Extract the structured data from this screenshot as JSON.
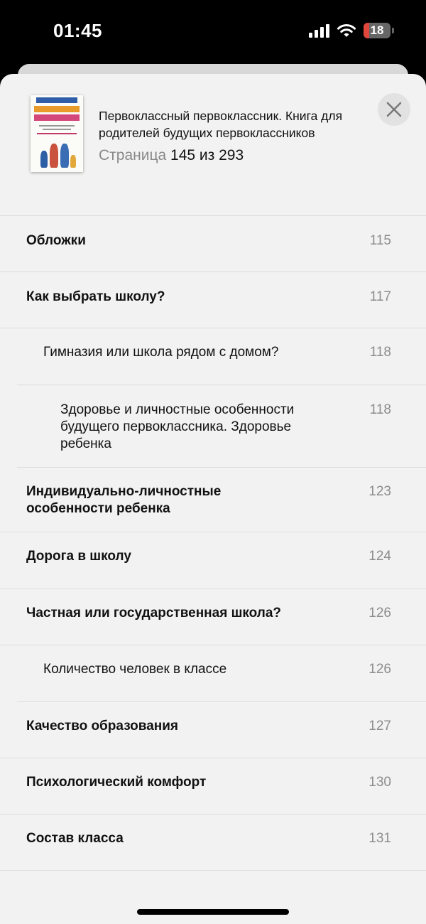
{
  "status_bar": {
    "time": "01:45",
    "battery_level": "18"
  },
  "book": {
    "title": "Первоклассный первоклассник. Книга для родителей будущих первоклассников",
    "page_label": "Страница",
    "page_current": "145",
    "page_of": "из",
    "page_total": "293"
  },
  "toc": [
    {
      "label": "Обложки",
      "page": "115",
      "level": 1
    },
    {
      "label": "Как выбрать школу?",
      "page": "117",
      "level": 1
    },
    {
      "label": "Гимназия или школа рядом с домом?",
      "page": "118",
      "level": 2
    },
    {
      "label": "Здоровье и личностные особенности будущего первоклассника. Здоровье ребенка",
      "page": "118",
      "level": 3
    },
    {
      "label": "Индивидуально-личностные особенности ребенка",
      "page": "123",
      "level": 1
    },
    {
      "label": "Дорога в школу",
      "page": "124",
      "level": 1
    },
    {
      "label": "Частная или государственная школа?",
      "page": "126",
      "level": 1
    },
    {
      "label": "Количество человек в классе",
      "page": "126",
      "level": 2
    },
    {
      "label": "Качество образования",
      "page": "127",
      "level": 1
    },
    {
      "label": "Психологический комфорт",
      "page": "130",
      "level": 1
    },
    {
      "label": "Состав класса",
      "page": "131",
      "level": 1
    }
  ]
}
